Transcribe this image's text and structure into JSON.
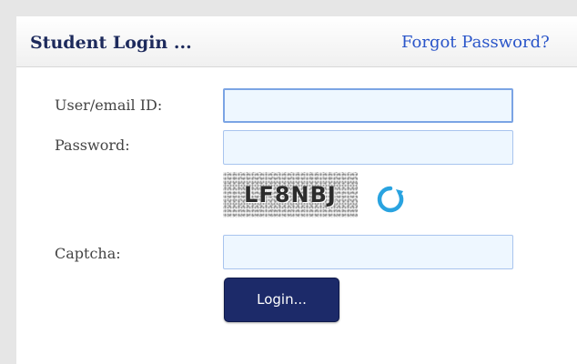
{
  "header": {
    "title": "Student Login ...",
    "forgot_password": "Forgot Password?"
  },
  "form": {
    "user_label": "User/email ID:",
    "user_value": "",
    "password_label": "Password:",
    "password_value": "",
    "captcha_image_text": "LF8NBJ",
    "refresh_icon": "refresh-icon",
    "captcha_label": "Captcha:",
    "captcha_value": "",
    "login_label": "Login..."
  },
  "colors": {
    "primary": "#1c2a69",
    "link": "#2a55c9",
    "input_bg": "#eef7ff",
    "refresh": "#29a3e0"
  }
}
